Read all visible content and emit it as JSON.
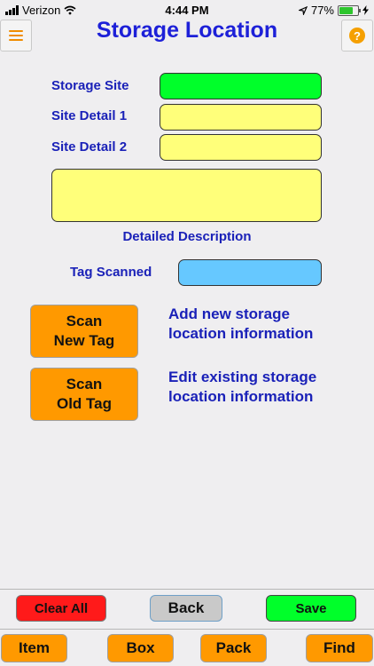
{
  "status_bar": {
    "carrier": "Verizon",
    "time": "4:44 PM",
    "battery_percent": "77%",
    "battery_level": 0.77
  },
  "header": {
    "title": "Storage Location"
  },
  "form": {
    "storage_site_label": "Storage Site",
    "site_detail_1_label": "Site Detail 1",
    "site_detail_2_label": "Site Detail 2",
    "detailed_description_label": "Detailed Description",
    "tag_scanned_label": "Tag Scanned",
    "storage_site_value": "",
    "site_detail_1_value": "",
    "site_detail_2_value": "",
    "detailed_description_value": "",
    "tag_scanned_value": ""
  },
  "actions": {
    "scan_new_tag_line1": "Scan",
    "scan_new_tag_line2": "New Tag",
    "scan_new_tag_desc": "Add new storage location information",
    "scan_old_tag_line1": "Scan",
    "scan_old_tag_line2": "Old Tag",
    "scan_old_tag_desc": "Edit existing storage location information"
  },
  "bottom_buttons": {
    "clear_all": "Clear All",
    "back": "Back",
    "save": "Save"
  },
  "tabs": {
    "item": "Item",
    "box": "Box",
    "pack": "Pack",
    "find": "Find"
  },
  "icons": {
    "menu": "hamburger-icon",
    "help": "help-icon",
    "help_glyph": "?"
  },
  "colors": {
    "title": "#1d20d8",
    "label": "#1a21b8",
    "storage_site_field": "#00ff2a",
    "detail_fields": "#ffff7a",
    "tag_field": "#66c8ff",
    "orange_button": "#ff9900",
    "clear_button": "#ff1a1a",
    "save_button": "#00ff2a",
    "back_button": "#c9c9c9"
  }
}
